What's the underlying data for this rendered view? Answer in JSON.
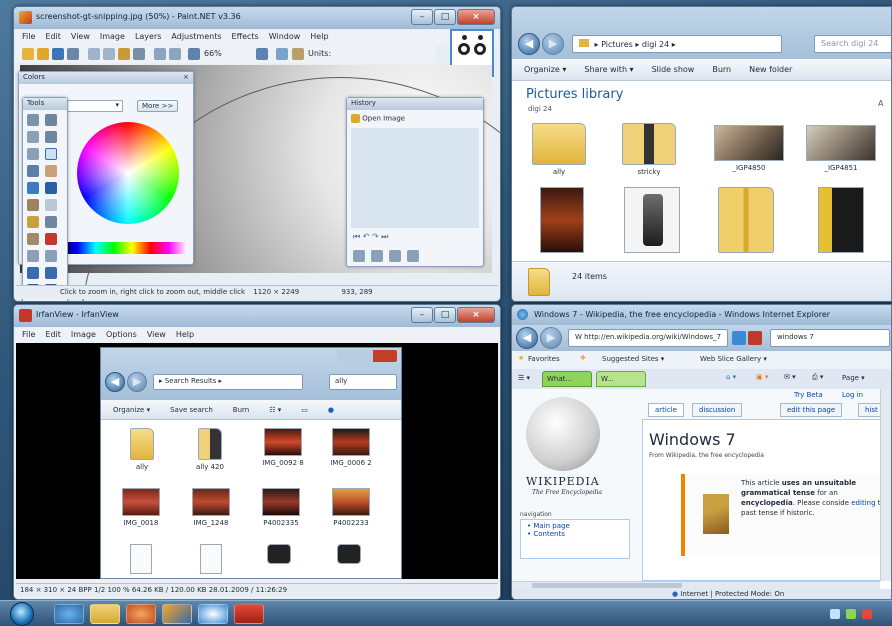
{
  "paint": {
    "title": "screenshot-gt-snipping.jpg (50%) - Paint.NET v3.36",
    "menu": [
      "File",
      "Edit",
      "View",
      "Image",
      "Layers",
      "Adjustments",
      "Effects",
      "Window",
      "Help"
    ],
    "zoom": "66%",
    "units_label": "Units:",
    "colors_title": "Colors",
    "colors_close": "×",
    "colors_more_btn": "More >>",
    "colors_dropdown": "",
    "tools_title": "Tools",
    "history_title": "History",
    "history_item": "Open Image",
    "status_hint": "Click to zoom in, right click to zoom out, middle click",
    "status_size": "1120 × 2249",
    "status_pos": "933, 289"
  },
  "explorer_top": {
    "breadcrumb": "▸ Pictures ▸ digi 24 ▸",
    "search_placeholder": "Search digi 24",
    "commands": [
      "Organize ▾",
      "Share with ▾",
      "Slide show",
      "Burn",
      "New folder"
    ],
    "library_title": "Pictures library",
    "library_sub": "digi 24",
    "arrange_letter": "A",
    "items": [
      {
        "label": "ally",
        "kind": "folder"
      },
      {
        "label": "stricky",
        "kind": "folder-phone"
      },
      {
        "label": "_IGP4850",
        "kind": "photo"
      },
      {
        "label": "_IGP4851",
        "kind": "photo2"
      },
      {
        "label": "",
        "kind": "poster"
      },
      {
        "label": "",
        "kind": "phone"
      },
      {
        "label": "",
        "kind": "zip"
      },
      {
        "label": "",
        "kind": "poster2"
      }
    ],
    "status": "24 items"
  },
  "irfan": {
    "title": "IrfanView - IrfanView",
    "menu": [
      "File",
      "Edit",
      "Image",
      "Options",
      "View",
      "Help"
    ],
    "status": "184 × 310 × 24 BPP   1/2   100 %   64.26 KB / 120.00 KB   28.01.2009 / 11:26:29",
    "inner": {
      "breadcrumb": "▸ Search Results ▸",
      "search_value": "ally",
      "commands": [
        "Organize ▾",
        "Save search",
        "Burn"
      ],
      "items": [
        {
          "label": "ally",
          "kind": "folder"
        },
        {
          "label": "ally 420",
          "kind": "folder-dark"
        },
        {
          "label": "IMG_0092 8",
          "kind": "car"
        },
        {
          "label": "IMG_0006 2",
          "kind": "car2"
        },
        {
          "label": "IMG_0018",
          "kind": "car3"
        },
        {
          "label": "IMG_1248",
          "kind": "car3"
        },
        {
          "label": "P4002335",
          "kind": "car4"
        },
        {
          "label": "P4002233",
          "kind": "car5"
        },
        {
          "label": "",
          "kind": "doc"
        },
        {
          "label": "",
          "kind": "doc"
        },
        {
          "label": "",
          "kind": "camera"
        },
        {
          "label": "",
          "kind": "camera"
        }
      ]
    }
  },
  "ie": {
    "title": "Windows 7 - Wikipedia, the free encyclopedia - Windows Internet Explorer",
    "url": "W http://en.wikipedia.org/wiki/Windows_7",
    "search_value": "windows 7",
    "favorites_label": "Favorites",
    "fav_links": [
      "Suggested Sites ▾",
      "Web Slice Gallery ▾"
    ],
    "tab_label": "What...",
    "tab2_label": "W...",
    "page_menu": "Page ▾",
    "user_links": [
      "Try Beta",
      "Log in"
    ],
    "article_tabs": [
      "article",
      "discussion",
      "edit this page",
      "hist"
    ],
    "heading": "Windows 7",
    "subheading": "From Wikipedia, the free encyclopedia",
    "wordmark": "WIKIPEDIA",
    "tagline": "The Free Encyclopedia",
    "nav_title": "navigation",
    "nav_links": [
      "Main page",
      "Contents"
    ],
    "notice_lead": "This article ",
    "notice_bold": "uses an unsuitable grammatical tense",
    "notice_mid": " for an ",
    "notice_bold2": "encyclopedia",
    "notice_tail": ". Please conside",
    "notice_link": "editing",
    "notice_end": " to past tense if historic.",
    "status": "Internet | Protected Mode: On"
  },
  "taskbar": {
    "buttons": [
      "ie",
      "explorer",
      "mediaplayer",
      "paintnet",
      "irfan",
      "explorer2",
      "media"
    ],
    "clock": ""
  }
}
